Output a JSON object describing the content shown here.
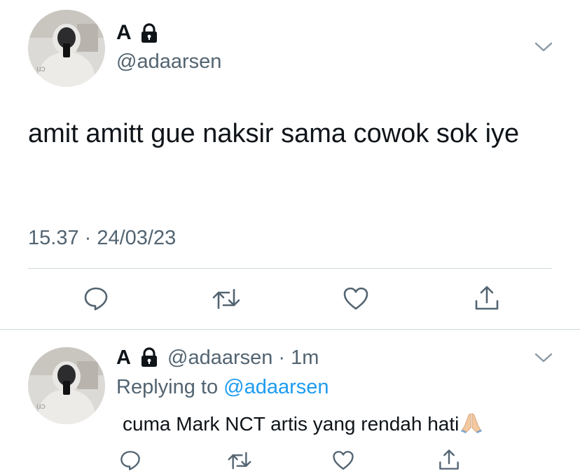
{
  "main_tweet": {
    "display_name": "A",
    "handle": "@adaarsen",
    "text": "amit amitt gue naksir sama cowok sok iye",
    "timestamp": "15.37 · 24/03/23",
    "avatar_icon": "profile-photo-mirror-selfie",
    "lock_icon": "lock-icon",
    "caret_icon": "chevron-down-icon",
    "actions": [
      "reply-icon",
      "retweet-icon",
      "like-icon",
      "share-icon"
    ]
  },
  "reply_tweet": {
    "display_name": "A",
    "handle_time": "@adaarsen · 1m",
    "replying_prefix": "Replying to ",
    "replying_to": "@adaarsen",
    "text": "cuma Mark NCT artis yang rendah hati",
    "emoji": "folded-hands-emoji",
    "actions": [
      "reply-icon",
      "retweet-icon",
      "like-icon",
      "share-icon"
    ]
  },
  "colors": {
    "text_primary": "#0f1419",
    "text_secondary": "#536471",
    "link": "#1d9bf0",
    "divider": "#cfd9de",
    "icon": "#536471"
  }
}
